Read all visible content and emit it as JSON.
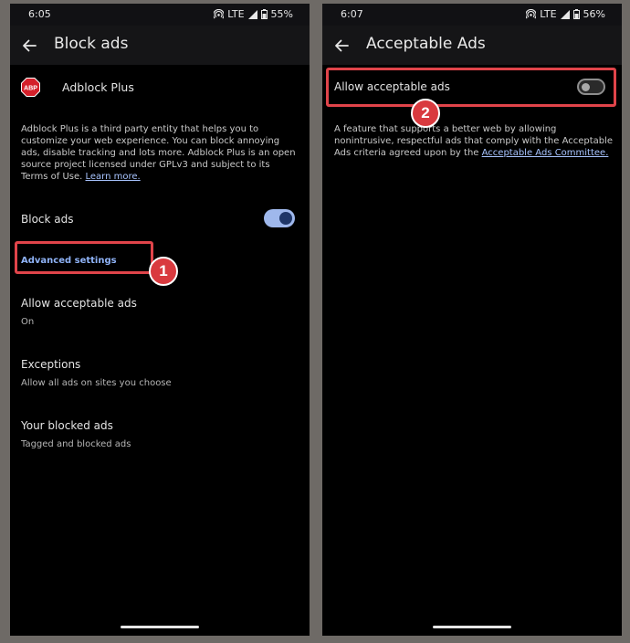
{
  "left": {
    "status": {
      "time": "6:05",
      "network": "LTE",
      "battery": "55%"
    },
    "app_bar": {
      "title": "Block ads"
    },
    "app_name": "Adblock Plus",
    "logo_text": "ABP",
    "description": "Adblock Plus is a third party entity that helps you to customize your web experience. You can block annoying ads, disable tracking and lots more. Adblock Plus is an open source project licensed under GPLv3 and subject to its Terms of Use.",
    "learn_more": "Learn more.",
    "block_ads": {
      "label": "Block ads",
      "enabled": true
    },
    "advanced_settings": "Advanced settings",
    "items": [
      {
        "title": "Allow acceptable ads",
        "subtitle": "On"
      },
      {
        "title": "Exceptions",
        "subtitle": "Allow all ads on sites you choose"
      },
      {
        "title": "Your blocked ads",
        "subtitle": "Tagged and blocked ads"
      }
    ],
    "callout": "1"
  },
  "right": {
    "status": {
      "time": "6:07",
      "network": "LTE",
      "battery": "56%"
    },
    "app_bar": {
      "title": "Acceptable Ads"
    },
    "toggle": {
      "label": "Allow acceptable ads",
      "enabled": false
    },
    "description": "A feature that supports a better web by allowing nonintrusive, respectful ads that comply with the Acceptable Ads criteria agreed upon by the",
    "committee_link": "Acceptable Ads Committee.",
    "callout": "2"
  },
  "colors": {
    "accent": "#a8c4ff",
    "highlight": "#e0444a",
    "toggle_on_track": "#9fb8ec",
    "toggle_on_knob": "#1f3667"
  },
  "icons": [
    "back-arrow-icon",
    "hotspot-icon",
    "signal-icon",
    "battery-icon",
    "abp-logo-icon"
  ]
}
